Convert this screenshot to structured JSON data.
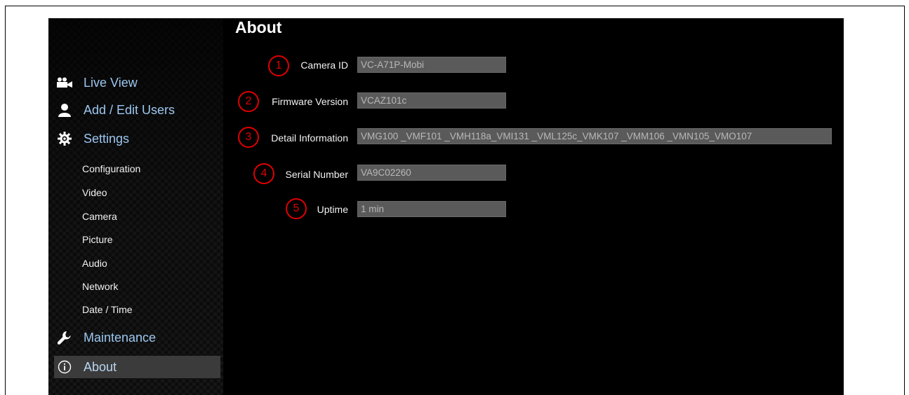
{
  "page": {
    "title": "About"
  },
  "sidebar": {
    "main_items": [
      {
        "label": "Live View",
        "icon": "video-camera-icon"
      },
      {
        "label": "Add / Edit Users",
        "icon": "user-icon"
      },
      {
        "label": "Settings",
        "icon": "gear-icon"
      },
      {
        "label": "Maintenance",
        "icon": "wrench-icon"
      },
      {
        "label": "About",
        "icon": "info-icon",
        "active": true
      }
    ],
    "settings_items": [
      {
        "label": "Configuration"
      },
      {
        "label": "Video"
      },
      {
        "label": "Camera"
      },
      {
        "label": "Picture"
      },
      {
        "label": "Audio"
      },
      {
        "label": "Network"
      },
      {
        "label": "Date / Time"
      }
    ]
  },
  "about": {
    "fields": [
      {
        "marker": "1",
        "label": "Camera ID",
        "value": "VC-A71P-Mobi"
      },
      {
        "marker": "2",
        "label": "Firmware Version",
        "value": "VCAZ101c"
      },
      {
        "marker": "3",
        "label": "Detail Information",
        "value": "VMG100 _VMF101 _VMH118a_VMI131 _VML125c_VMK107 _VMM106 _VMN105_VMO107"
      },
      {
        "marker": "4",
        "label": "Serial Number",
        "value": "VA9C02260"
      },
      {
        "marker": "5",
        "label": "Uptime",
        "value": "1 min"
      }
    ]
  },
  "colors": {
    "nav_link": "#9cc7f1",
    "marker": "#e00000",
    "field_bg": "#5a5a5a",
    "app_bg": "#000000"
  }
}
